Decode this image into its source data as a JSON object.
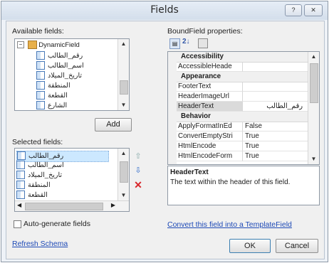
{
  "window": {
    "title": "Fields",
    "help_glyph": "?",
    "close_glyph": "✕"
  },
  "available": {
    "label": "Available fields:",
    "root": "DynamicField",
    "items": [
      "رقم_الطالب",
      "اسم_الطالب",
      "تاريخ_الميلاد",
      "المنطقة",
      "القطعة",
      "الشارع"
    ]
  },
  "add_button": "Add",
  "selected": {
    "label": "Selected fields:",
    "items": [
      "رقم_الطالب",
      "اسم_الطالب",
      "تاريخ_الميلاد",
      "المنطقة",
      "القطعة"
    ]
  },
  "auto_generate": {
    "label": "Auto-generate fields",
    "checked": false
  },
  "refresh_link": "Refresh Schema",
  "props": {
    "label": "BoundField properties:",
    "categories": [
      {
        "name": "Accessibility",
        "rows": [
          {
            "name": "AccessibleHeade",
            "value": ""
          }
        ]
      },
      {
        "name": "Appearance",
        "rows": [
          {
            "name": "FooterText",
            "value": ""
          },
          {
            "name": "HeaderImageUrl",
            "value": ""
          },
          {
            "name": "HeaderText",
            "value": "رقم_الطالب"
          }
        ]
      },
      {
        "name": "Behavior",
        "rows": [
          {
            "name": "ApplyFormatInEd",
            "value": "False"
          },
          {
            "name": "ConvertEmptyStri",
            "value": "True"
          },
          {
            "name": "HtmlEncode",
            "value": "True"
          },
          {
            "name": "HtmlEncodeForm",
            "value": "True"
          }
        ]
      }
    ],
    "desc_title": "HeaderText",
    "desc_text": "The text within the header of this field."
  },
  "convert_link": "Convert this field into a TemplateField",
  "ok_button": "OK",
  "cancel_button": "Cancel",
  "colors": {
    "link": "#1d49b6",
    "selected": "#cce8ff",
    "delete": "#d8262b"
  }
}
